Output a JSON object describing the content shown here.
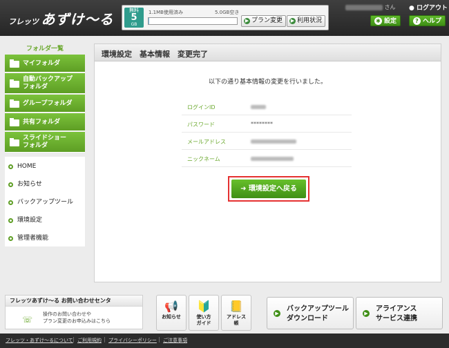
{
  "header": {
    "logo_small": "フレッツ",
    "logo_big": "あずけ〜る",
    "plan_badge": {
      "line1": "無料",
      "line2": "5",
      "line3": "GB"
    },
    "used_text": "1.1MB使用済み",
    "free_text": "5.0GB空き",
    "usage_fraction": 0.01,
    "plan_change_label": "プラン変更",
    "usage_status_label": "利用状況",
    "user_suffix": "さん",
    "logout_label": "ログアウト",
    "settings_label": "設定",
    "help_label": "ヘルプ"
  },
  "sidebar": {
    "folder_heading": "フォルダ一覧",
    "folders": [
      {
        "label": "マイフォルダ"
      },
      {
        "label": "自動バックアップ\nフォルダ"
      },
      {
        "label": "グループフォルダ"
      },
      {
        "label": "共有フォルダ"
      },
      {
        "label": "スライドショー\nフォルダ"
      }
    ],
    "nav": [
      {
        "label": "HOME"
      },
      {
        "label": "お知らせ"
      },
      {
        "label": "バックアップツール"
      },
      {
        "label": "環境設定"
      },
      {
        "label": "管理者機能"
      }
    ]
  },
  "main": {
    "title": "環境設定　基本情報　変更完了",
    "message": "以下の通り基本情報の変更を行いました。",
    "rows": [
      {
        "label": "ログインID"
      },
      {
        "label": "パスワード",
        "value": "********"
      },
      {
        "label": "メールアドレス"
      },
      {
        "label": "ニックネーム"
      }
    ],
    "back_button": "環境設定へ戻る"
  },
  "footer": {
    "contact_title": "フレッツあずけ〜る お問い合わせセンタ",
    "contact_line1": "操作のお問い合わせや",
    "contact_line2": "プラン変更のお申込みはこちら",
    "tiles": [
      {
        "label": "お知らせ"
      },
      {
        "label": "使い方\nガイド"
      },
      {
        "label": "アドレス\n帳"
      }
    ],
    "big_buttons": [
      {
        "label": "バックアップツール\nダウンロード"
      },
      {
        "label": "アライアンス\nサービス連携"
      }
    ],
    "links": [
      "フレッツ・あずけ〜るについて",
      "ご利用規約",
      "プライバシーポリシー",
      "ご注意事項"
    ]
  }
}
